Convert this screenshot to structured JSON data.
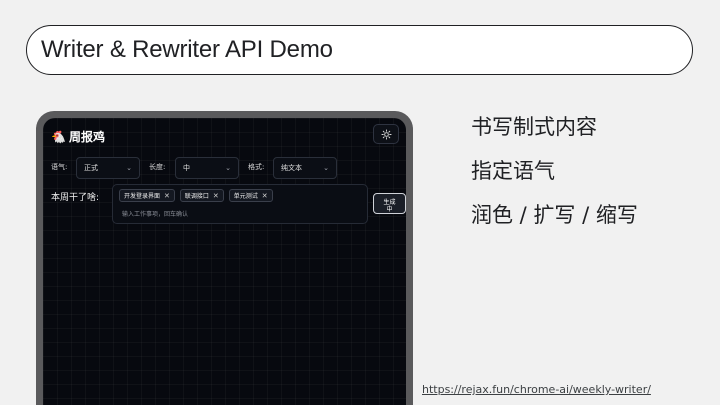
{
  "slide": {
    "title": "Writer & Rewriter API Demo",
    "url": "https://rejax.fun/chrome-ai/weekly-writer/"
  },
  "features": [
    "书写制式内容",
    "指定语气",
    "润色 / 扩写 / 缩写"
  ],
  "app": {
    "logo_icon": "chicken-icon",
    "title": "周报鸡",
    "theme_icon": "sun-icon",
    "controls": {
      "tone_label": "语气:",
      "tone_value": "正式",
      "length_label": "长度:",
      "length_value": "中",
      "format_label": "格式:",
      "format_value": "纯文本"
    },
    "prompt_label": "本周干了啥:",
    "tags": [
      "开发登录界面",
      "联调接口",
      "单元测试"
    ],
    "input_placeholder": "输入工作事项，回车确认",
    "generate_label": "生成中"
  },
  "colors": {
    "slide_bg": "#f1f1f1",
    "screen_bg": "#07090f",
    "device_frame": "#5a5a5c",
    "logo_accent": "#ff8c3a"
  }
}
